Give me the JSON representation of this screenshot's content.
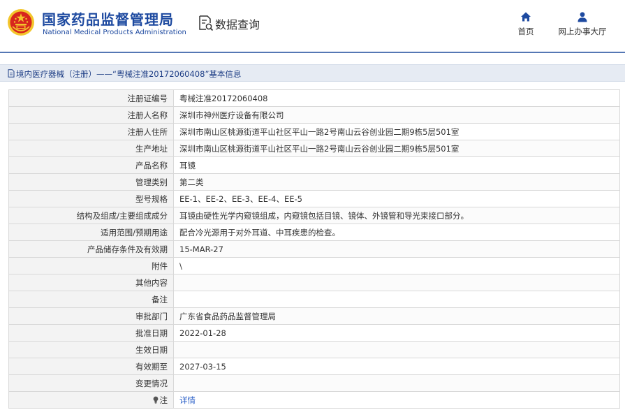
{
  "header": {
    "logo_cn": "国家药品监督管理局",
    "logo_en": "National Medical Products Administration",
    "data_search": "数据查询",
    "nav": {
      "home": "首页",
      "online_hall": "网上办事大厅"
    }
  },
  "breadcrumb": {
    "text": "境内医疗器械（注册）——“粤械注准20172060408”基本信息"
  },
  "details": [
    {
      "label": "注册证编号",
      "value": "粤械注准20172060408"
    },
    {
      "label": "注册人名称",
      "value": "深圳市神州医疗设备有限公司"
    },
    {
      "label": "注册人住所",
      "value": "深圳市南山区桃源街道平山社区平山一路2号南山云谷创业园二期9栋5层501室"
    },
    {
      "label": "生产地址",
      "value": "深圳市南山区桃源街道平山社区平山一路2号南山云谷创业园二期9栋5层501室"
    },
    {
      "label": "产品名称",
      "value": "耳镜"
    },
    {
      "label": "管理类别",
      "value": "第二类"
    },
    {
      "label": "型号规格",
      "value": "EE-1、EE-2、EE-3、EE-4、EE-5"
    },
    {
      "label": "结构及组成/主要组成成分",
      "value": "耳镜由硬性光学内窥镜组成，内窥镜包括目镜、镜体、外镜管和导光束接口部分。"
    },
    {
      "label": "适用范围/预期用途",
      "value": "配合冷光源用于对外耳道、中耳疾患的检查。"
    },
    {
      "label": "产品储存条件及有效期",
      "value": "15-MAR-27"
    },
    {
      "label": "附件",
      "value": "\\"
    },
    {
      "label": "其他内容",
      "value": ""
    },
    {
      "label": "备注",
      "value": ""
    },
    {
      "label": "审批部门",
      "value": "广东省食品药品监督管理局"
    },
    {
      "label": "批准日期",
      "value": "2022-01-28"
    },
    {
      "label": "生效日期",
      "value": ""
    },
    {
      "label": "有效期至",
      "value": "2027-03-15"
    },
    {
      "label": "变更情况",
      "value": ""
    }
  ],
  "note": {
    "label": "注",
    "link": "详情"
  },
  "colors": {
    "brand_blue": "#1e4aa0",
    "header_line": "#5577b4",
    "breadcrumb_bg": "#e6ebf3",
    "label_bg": "#f3f3f3",
    "link": "#2b60c8",
    "emblem_red": "#d7261e",
    "emblem_gold": "#f3c62c"
  },
  "icons": {
    "emblem": "national-emblem-icon",
    "data_search": "document-search-icon",
    "home": "home-icon",
    "online_hall": "user-icon",
    "breadcrumb": "document-icon",
    "note": "lightbulb-icon"
  }
}
